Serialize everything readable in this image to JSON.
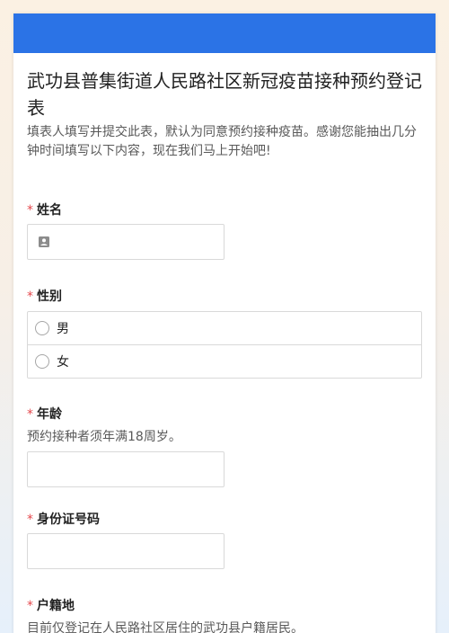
{
  "form": {
    "title": "武功县普集街道人民路社区新冠疫苗接种预约登记表",
    "description": "填表人填写并提交此表，默认为同意预约接种疫苗。感谢您能抽出几分钟时间填写以下内容，现在我们马上开始吧!"
  },
  "colors": {
    "header": "#2b73e6",
    "required": "#e5484d"
  },
  "fields": {
    "name": {
      "required_mark": "*",
      "label": "姓名",
      "icon": "contact-card-icon"
    },
    "gender": {
      "required_mark": "*",
      "label": "性别",
      "options": [
        "男",
        "女"
      ]
    },
    "age": {
      "required_mark": "*",
      "label": "年龄",
      "hint": "预约接种者须年满18周岁。"
    },
    "id_number": {
      "required_mark": "*",
      "label": "身份证号码"
    },
    "household": {
      "required_mark": "*",
      "label": "户籍地",
      "hint": "目前仅登记在人民路社区居住的武功县户籍居民。"
    }
  }
}
